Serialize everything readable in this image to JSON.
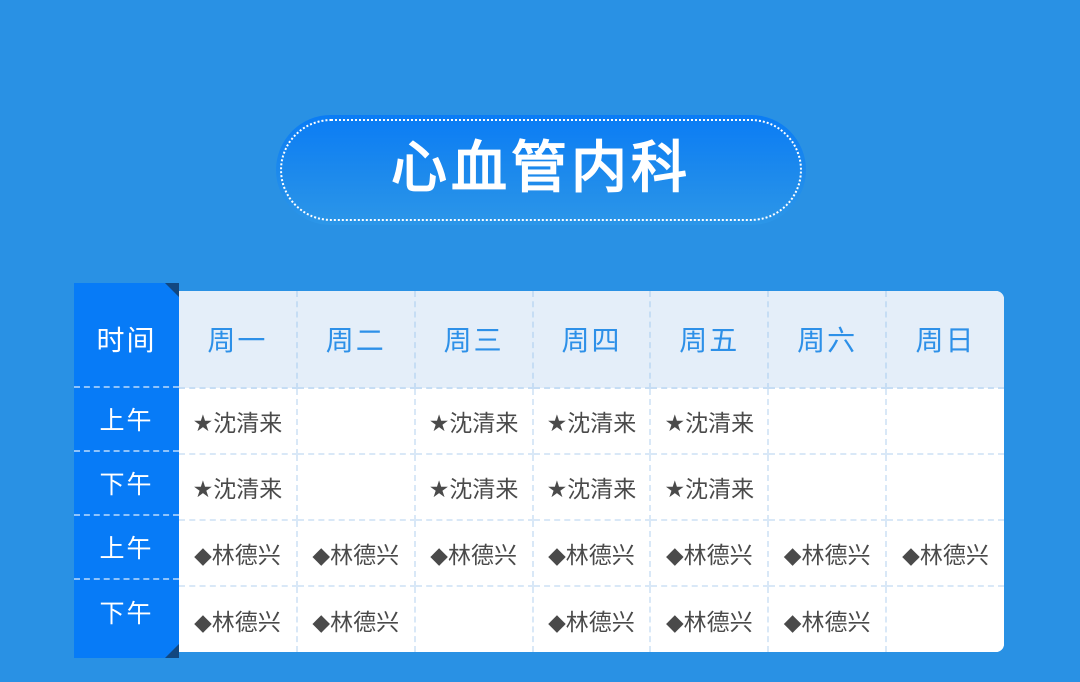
{
  "page": {
    "background_color": "#2991E4",
    "title": "心血管内科"
  },
  "theme": {
    "accent_blue": "#077BF7",
    "header_cell_bg": "#E4EEF9",
    "header_text": "#2D90E8",
    "body_text": "#4A4A4A",
    "grid_line": "#D9E8F7",
    "ribbon_fold": "#12477F",
    "panel_bg": "#FFFFFF"
  },
  "schedule": {
    "time_header": "时间",
    "day_headers": [
      "周一",
      "周二",
      "周三",
      "周四",
      "周五",
      "周六",
      "周日"
    ],
    "row_labels": [
      "上午",
      "下午",
      "上午",
      "下午"
    ],
    "doctors": [
      {
        "name": "沈清来",
        "marker": "★",
        "marker_name": "star-marker"
      },
      {
        "name": "林德兴",
        "marker": "◆",
        "marker_name": "diamond-marker"
      }
    ],
    "rows": [
      {
        "label": "上午",
        "cells": [
          "★沈清来",
          "",
          "★沈清来",
          "★沈清来",
          "★沈清来",
          "",
          ""
        ]
      },
      {
        "label": "下午",
        "cells": [
          "★沈清来",
          "",
          "★沈清来",
          "★沈清来",
          "★沈清来",
          "",
          ""
        ]
      },
      {
        "label": "上午",
        "cells": [
          "◆林德兴",
          "◆林德兴",
          "◆林德兴",
          "◆林德兴",
          "◆林德兴",
          "◆林德兴",
          "◆林德兴"
        ]
      },
      {
        "label": "下午",
        "cells": [
          "◆林德兴",
          "◆林德兴",
          "",
          "◆林德兴",
          "◆林德兴",
          "◆林德兴",
          ""
        ]
      }
    ]
  }
}
